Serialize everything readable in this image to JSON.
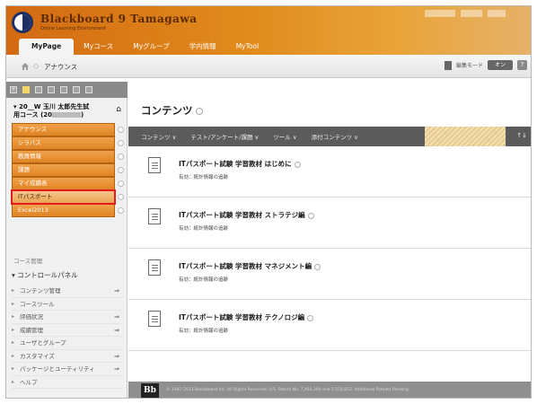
{
  "header": {
    "brand_title": "Blackboard 9 Tamagawa",
    "brand_subtitle": "Online Learning Environment",
    "tabs": [
      {
        "label": "MyPage",
        "active": true
      },
      {
        "label": "Myコース",
        "active": false
      },
      {
        "label": "Myグループ",
        "active": false
      },
      {
        "label": "学内情報",
        "active": false
      },
      {
        "label": "MyTool",
        "active": false
      }
    ]
  },
  "breadcrumb": {
    "current": "アナウンス"
  },
  "edit_mode": {
    "label": "編集モード",
    "state": "オン",
    "help": "?"
  },
  "sidebar": {
    "course_title_line1": "20__W 玉川 太郎先生試",
    "course_title_line2": "用コース (20",
    "course_title_end": ")",
    "menu_items": [
      {
        "label": "アナウンス",
        "selected": false
      },
      {
        "label": "シラバス",
        "selected": false
      },
      {
        "label": "教員情報",
        "selected": false
      },
      {
        "label": "課題",
        "selected": false
      },
      {
        "label": "マイ成績表",
        "selected": false
      },
      {
        "label": "ITパスポート",
        "selected": true
      },
      {
        "label": "Excel2013",
        "selected": false
      }
    ],
    "management_label": "コース管理",
    "control_panel_title": "コントロールパネル",
    "panel_items": [
      {
        "label": "コンテンツ管理",
        "has_arrow": true
      },
      {
        "label": "コースツール",
        "has_arrow": false
      },
      {
        "label": "評価状況",
        "has_arrow": true
      },
      {
        "label": "成績管理",
        "has_arrow": true
      },
      {
        "label": "ユーザとグループ",
        "has_arrow": false
      },
      {
        "label": "カスタマイズ",
        "has_arrow": true
      },
      {
        "label": "パッケージとユーティリティ",
        "has_arrow": true
      },
      {
        "label": "ヘルプ",
        "has_arrow": false
      }
    ]
  },
  "main": {
    "title": "コンテンツ",
    "actions": [
      "コンテンツ ∨",
      "テスト/アンケート/課題 ∨",
      "ツール ∨",
      "添付コンテンツ ∨"
    ],
    "sort_label": "↑↓",
    "items": [
      {
        "title": "ITパスポート試験 学習教材 はじめに",
        "sub": "有効：統計情報の追跡"
      },
      {
        "title": "ITパスポート試験 学習教材 ストラテジ編",
        "sub": "有効：統計情報の追跡"
      },
      {
        "title": "ITパスポート試験 学習教材 マネジメント編",
        "sub": "有効：統計情報の追跡"
      },
      {
        "title": "ITパスポート試験 学習教材 テクノロジ編",
        "sub": "有効：統計情報の追跡"
      }
    ]
  },
  "footer": {
    "logo": "Bb",
    "text": "© 1997-2013 Blackboard Inc. All Rights Reserved. U.S. Patent No. 7,493,396 and 7,558,853. Additional Patents Pending."
  },
  "colors": {
    "header_orange": "#e08a1c",
    "menu_orange": "#df8423",
    "highlight_red": "#e21b1b",
    "action_bar": "#5b5b5b"
  }
}
